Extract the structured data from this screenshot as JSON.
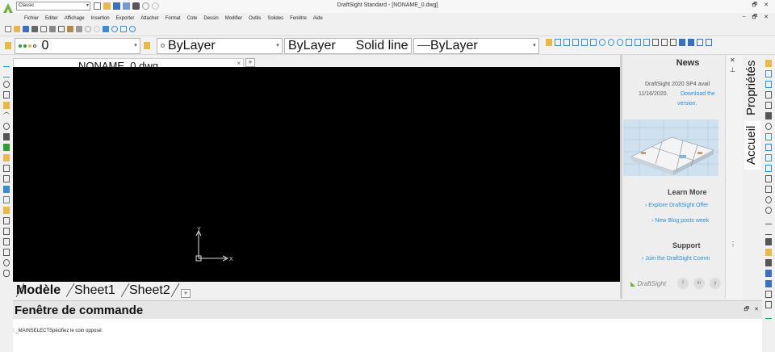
{
  "window": {
    "title": "DraftSight Standard - [NONAME_0.dwg]",
    "workspace": "Classic"
  },
  "menu": [
    "Fichier",
    "Editer",
    "Affichage",
    "Insertion",
    "Exporter",
    "Attacher",
    "Format",
    "Cote",
    "Dessin",
    "Modifier",
    "Outils",
    "Solides",
    "Fenêtre",
    "Aide"
  ],
  "properties": {
    "layer": "0",
    "color": "ByLayer",
    "linetype_style": "ByLayer",
    "linetype": "Solid line",
    "lineweight": "ByLayer"
  },
  "document": {
    "tab_label": "NONAME_0.dwg",
    "close_glyph": "×",
    "add_glyph": "+"
  },
  "canvas": {
    "axis_x": "X",
    "axis_y": "Y"
  },
  "layout_tabs": [
    "Modèle",
    "Sheet1",
    "Sheet2"
  ],
  "command": {
    "title": "Fenêtre de commande",
    "output": ": _MAINSELECTSpécifiez le coin opposé:"
  },
  "news": {
    "title": "News",
    "text_1": "DraftSight 2020 SP4 avail",
    "text_2": "11/16/2020.",
    "link_1": "Download the",
    "link_2": "version.",
    "learn_title": "Learn More",
    "learn_link_1": "› Explore DraftSight Offer",
    "learn_link_2": "› New Blog posts week",
    "support_title": "Support",
    "support_link_1": "› Join the DraftSight Comm",
    "footer_logo": "DraftSight",
    "social": [
      "f",
      "in",
      "y"
    ]
  },
  "panel_tabs": {
    "home": "Accueil",
    "properties": "Propriétés"
  },
  "colors": {
    "accent": "#2a8fd4",
    "canvas": "#000000",
    "brand_green": "#6db33f"
  }
}
